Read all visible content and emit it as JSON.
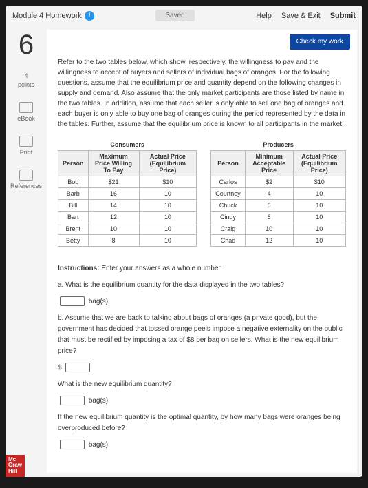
{
  "header": {
    "title": "Module 4 Homework",
    "saved": "Saved",
    "help": "Help",
    "save_exit": "Save & Exit",
    "submit": "Submit"
  },
  "question": {
    "number": "6",
    "points_val": "4",
    "points_lbl": "points"
  },
  "side": {
    "ebook": "eBook",
    "print": "Print",
    "references": "References"
  },
  "check": "Check my work",
  "intro": "Refer to the two tables below, which show, respectively, the willingness to pay and the willingness to accept of buyers and sellers of individual bags of oranges. For the following questions, assume that the equilibrium price and quantity depend on the following changes in supply and demand. Also assume that the only market participants are those listed by name in the two tables. In addition, assume that each seller is only able to sell one bag of oranges and each buyer is only able to buy one bag of oranges during the period represented by the data in the tables. Further, assume that the equilibrium price is known to all participants in the market.",
  "consumers": {
    "title": "Consumers",
    "h1": "Person",
    "h2": "Maximum Price Willing To Pay",
    "h3": "Actual Price (Equilibrium Price)",
    "rows": [
      {
        "p": "Bob",
        "m": "$21",
        "a": "$10"
      },
      {
        "p": "Barb",
        "m": "16",
        "a": "10"
      },
      {
        "p": "Bill",
        "m": "14",
        "a": "10"
      },
      {
        "p": "Bart",
        "m": "12",
        "a": "10"
      },
      {
        "p": "Brent",
        "m": "10",
        "a": "10"
      },
      {
        "p": "Betty",
        "m": "8",
        "a": "10"
      }
    ]
  },
  "producers": {
    "title": "Producers",
    "h1": "Person",
    "h2": "Minimum Acceptable Price",
    "h3": "Actual Price (Equilibrium Price)",
    "rows": [
      {
        "p": "Carlos",
        "m": "$2",
        "a": "$10"
      },
      {
        "p": "Courtney",
        "m": "4",
        "a": "10"
      },
      {
        "p": "Chuck",
        "m": "6",
        "a": "10"
      },
      {
        "p": "Cindy",
        "m": "8",
        "a": "10"
      },
      {
        "p": "Craig",
        "m": "10",
        "a": "10"
      },
      {
        "p": "Chad",
        "m": "12",
        "a": "10"
      }
    ]
  },
  "instr": {
    "lead": "Instructions:",
    "lead_txt": " Enter your answers as a whole number.",
    "qa": "a. What is the equilibrium quantity for the data displayed in the two tables?",
    "bags": "bag(s)",
    "qb": "b. Assume that we are back to talking about bags of oranges (a private good), but the government has decided that tossed orange peels impose a negative externality on the public that must be rectified by imposing a tax of $8 per bag on sellers. What is the new equilibrium price?",
    "dollar": "$",
    "qb2": "What is the new equilibrium quantity?",
    "qc": "If the new equilibrium quantity is the optimal quantity, by how many bags were oranges being overproduced before?"
  },
  "brand": {
    "l1": "Mc",
    "l2": "Graw",
    "l3": "Hill"
  }
}
